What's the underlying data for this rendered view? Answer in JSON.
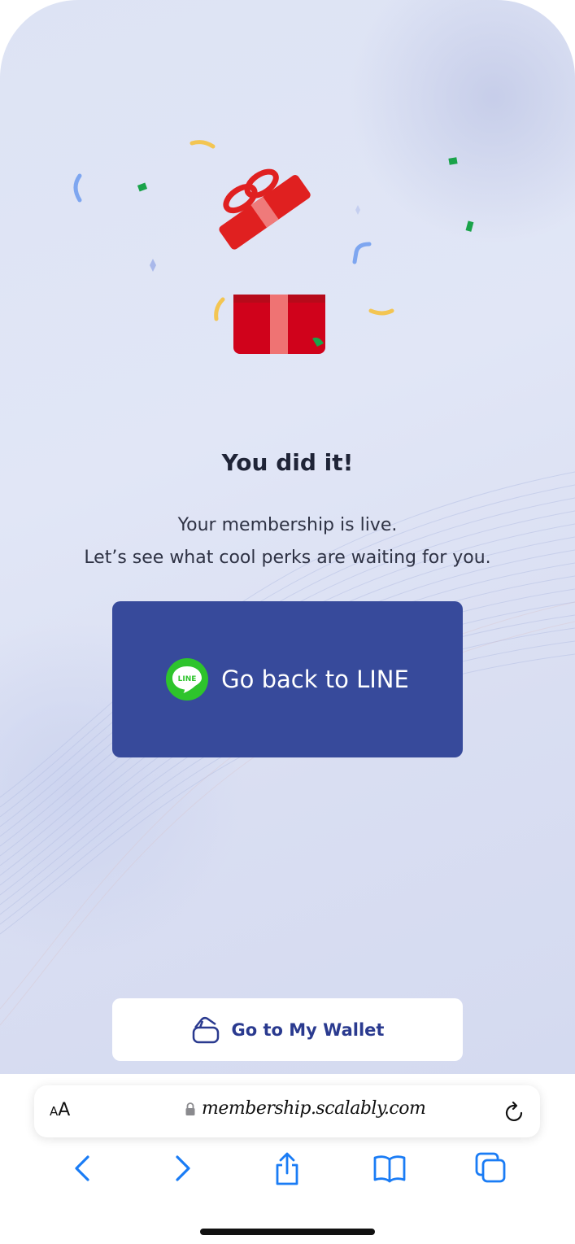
{
  "main": {
    "title": "You did it!",
    "subtitle_line1": "Your membership is live.",
    "subtitle_line2": "Let’s see what cool perks are waiting for you."
  },
  "line_button": {
    "badge_text": "LINE",
    "label": "Go back to LINE"
  },
  "wallet_button": {
    "label": "Go to My Wallet"
  },
  "browser": {
    "text_size_small": "A",
    "text_size_large": "A",
    "url": "membership.scalably.com"
  },
  "colors": {
    "primary_button": "#374a9b",
    "line_green": "#2ec42c",
    "ios_blue": "#1a7cf5"
  }
}
